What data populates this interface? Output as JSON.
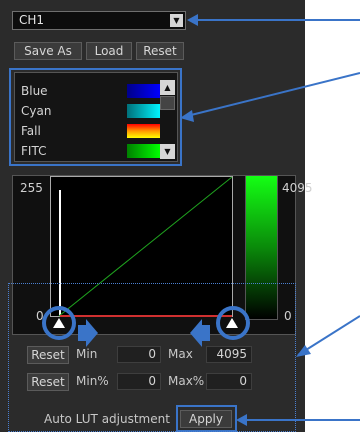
{
  "channel": {
    "selected": "CH1"
  },
  "toolbar": {
    "save_as": "Save As",
    "load": "Load",
    "reset": "Reset"
  },
  "lut_list": {
    "items": [
      {
        "label": "Blue",
        "swatch": "linear-gradient(to right,#00008a,#0000ff)"
      },
      {
        "label": "Cyan",
        "swatch": "linear-gradient(to right,#00707a,#00f5ff)"
      },
      {
        "label": "Fall",
        "swatch": "linear-gradient(to bottom,#ff0000,#ff9900,#ffff00)"
      },
      {
        "label": "FITC",
        "swatch": "linear-gradient(to right,#008000,#00ff00)"
      }
    ]
  },
  "histogram": {
    "left_max": "255",
    "right_max": "4095",
    "right_min": "0",
    "left_min": "0"
  },
  "minmax": {
    "reset": "Reset",
    "min_label": "Min",
    "min_value": "0",
    "max_label": "Max",
    "max_value": "4095"
  },
  "percent": {
    "reset": "Reset",
    "min_label": "Min%",
    "min_value": "0",
    "max_label": "Max%",
    "max_value": "0"
  },
  "auto": {
    "label": "Auto LUT adjustment",
    "apply": "Apply"
  },
  "colors": {
    "accent": "#3a74c8",
    "curve": "#1fa31f"
  }
}
